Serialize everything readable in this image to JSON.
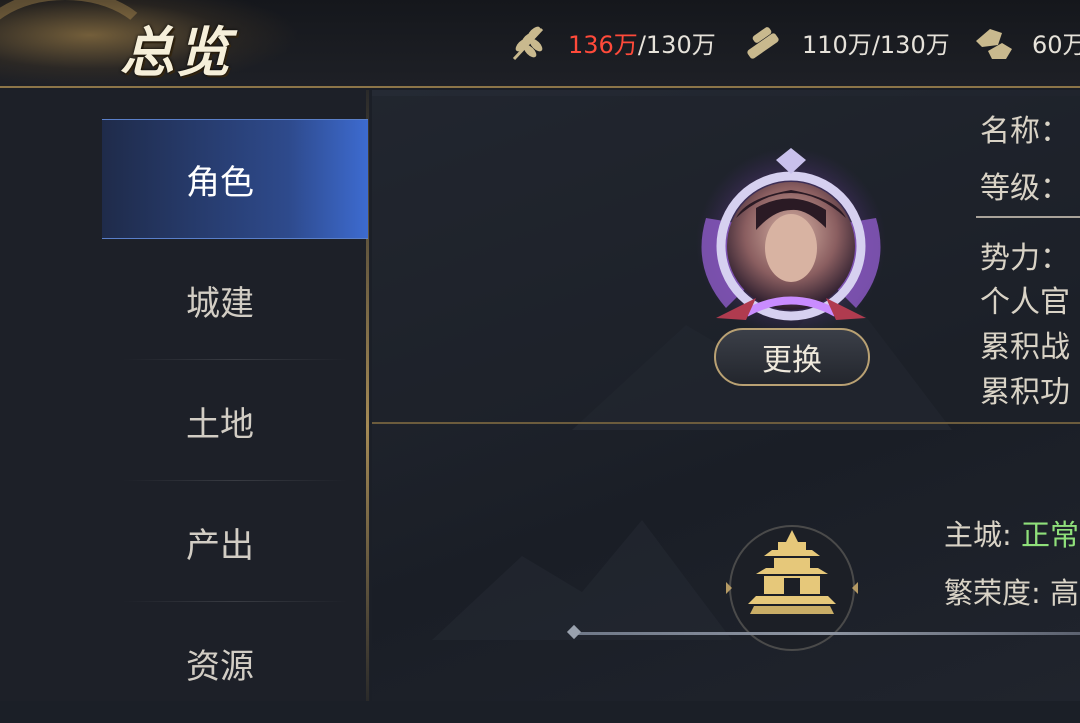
{
  "header": {
    "title": "总览",
    "resources": [
      {
        "icon": "grain-icon",
        "current": "136万",
        "max": "/130万",
        "over": true
      },
      {
        "icon": "wood-icon",
        "current": "110万",
        "max": "/130万",
        "over": false
      },
      {
        "icon": "stone-icon",
        "current": "60万",
        "max": "",
        "over": false
      }
    ]
  },
  "sidebar": {
    "items": [
      {
        "label": "角色",
        "active": true
      },
      {
        "label": "城建",
        "active": false
      },
      {
        "label": "土地",
        "active": false
      },
      {
        "label": "产出",
        "active": false
      },
      {
        "label": "资源",
        "active": false
      }
    ]
  },
  "profile": {
    "change_label": "更换",
    "name_label": "名称：",
    "level_label": "等级：",
    "faction_label": "势力：",
    "personal_rank_label": "个人官",
    "battle_label": "累积战",
    "merit_label": "累积功"
  },
  "city": {
    "main_label": "主城: ",
    "main_status": "正常",
    "prosperity_label": "繁荣度: ",
    "prosperity_value": "高"
  },
  "colors": {
    "accent_blue": "#3d6bd0",
    "gold": "#b9a173",
    "over_red": "#ff4a3a",
    "status_green": "#8fe07a"
  }
}
